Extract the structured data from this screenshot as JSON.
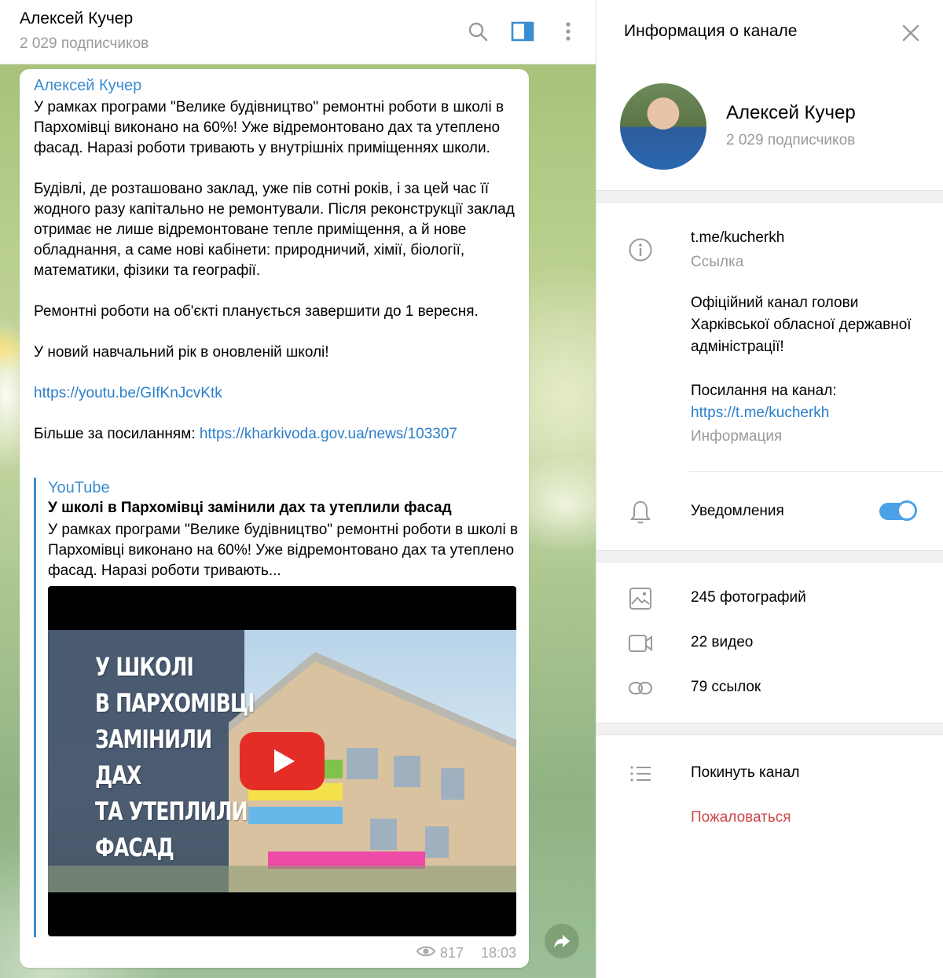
{
  "chat": {
    "title": "Алексей Кучер",
    "subtitle": "2 029 подписчиков",
    "icons": [
      "search-icon",
      "sidebar-toggle-icon",
      "more-vertical-icon"
    ]
  },
  "message": {
    "author": "Алексей Кучер",
    "paragraphs": [
      "У рамках програми \"Велике будівництво\" ремонтні роботи в школі в Пархомівці виконано на 60%! Уже відремонтовано дах та утеплено фасад. Наразі роботи тривають у внутрішніх приміщеннях школи.",
      "Будівлі, де розташовано заклад, уже пів сотні років, і за цей час її жодного разу капітально не ремонтували. Після реконструкції заклад отримає не лише відремонтоване тепле приміщення, а й нове обладнання, а саме нові кабінети: природничий, хімії, біології, математики, фізики та географії.",
      "Ремонтні роботи на об'єкті планується завершити до 1 вересня.",
      "У новий навчальний рік в оновленій школі!"
    ],
    "youtube_link": "https://youtu.be/GIfKnJcvKtk",
    "more_prefix": "Більше за посиланням: ",
    "more_link": "https://kharkivoda.gov.ua/news/103307",
    "preview": {
      "site": "YouTube",
      "title": "У школі в Пархомівці замінили дах та утеплили фасад",
      "description": "У рамках програми \"Велике будівництво\" ремонтні роботи в школі в Пархомівці виконано на 60%! Уже відремонтовано дах та утеплено фасад. Наразі роботи тривають...",
      "thumbnail_caption": [
        "У ШКОЛІ",
        "В ПАРХОМІВЦІ",
        "ЗАМІНИЛИ",
        "ДАХ",
        "ТА УТЕПЛИЛИ",
        "ФАСАД"
      ]
    },
    "views": "817",
    "time": "18:03"
  },
  "info_panel": {
    "header_title": "Информация о канале",
    "name": "Алексей Кучер",
    "subscribers": "2 029 подписчиков",
    "username_link": "t.me/kucherkh",
    "username_label": "Ссылка",
    "description": "Офіційний канал голови Харківської обласної державної адміністрації!",
    "channel_link_prefix": "Посилання на канал:",
    "channel_link": "https://t.me/kucherkh",
    "description_label": "Информация",
    "notifications_label": "Уведомления",
    "notifications_enabled": true,
    "photos": "245 фотографий",
    "videos": "22 видео",
    "links": "79 ссылок",
    "leave": "Покинуть канал",
    "report": "Пожаловаться",
    "accent_color": "#4aa1e8",
    "danger_color": "#d0464b"
  }
}
